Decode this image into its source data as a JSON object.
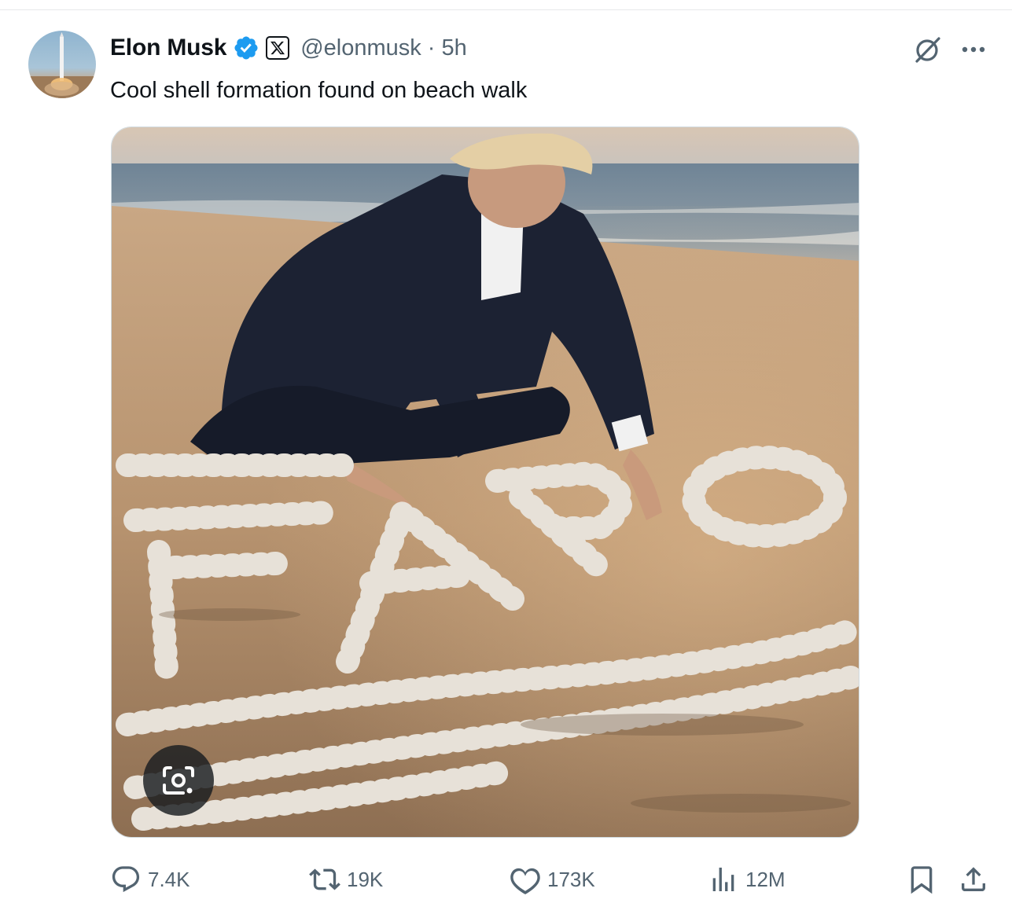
{
  "author": {
    "name": "Elon Musk",
    "handle": "@elonmusk",
    "separator": "·",
    "time": "5h"
  },
  "post": {
    "text": "Cool shell formation found on beach walk"
  },
  "icons": {
    "verified": "verified-badge-icon",
    "affiliate": "x-logo-icon",
    "grok": "grok-icon",
    "more": "more-icon",
    "lens": "google-lens-icon",
    "reply": "reply-icon",
    "repost": "repost-icon",
    "like": "like-icon",
    "views": "views-icon",
    "bookmark": "bookmark-icon",
    "share": "share-icon"
  },
  "actions": {
    "replies": "7.4K",
    "reposts": "19K",
    "likes": "173K",
    "views": "12M"
  },
  "colors": {
    "verified_blue": "#1d9bf0",
    "muted_text": "#536471",
    "text": "#0f1419"
  }
}
